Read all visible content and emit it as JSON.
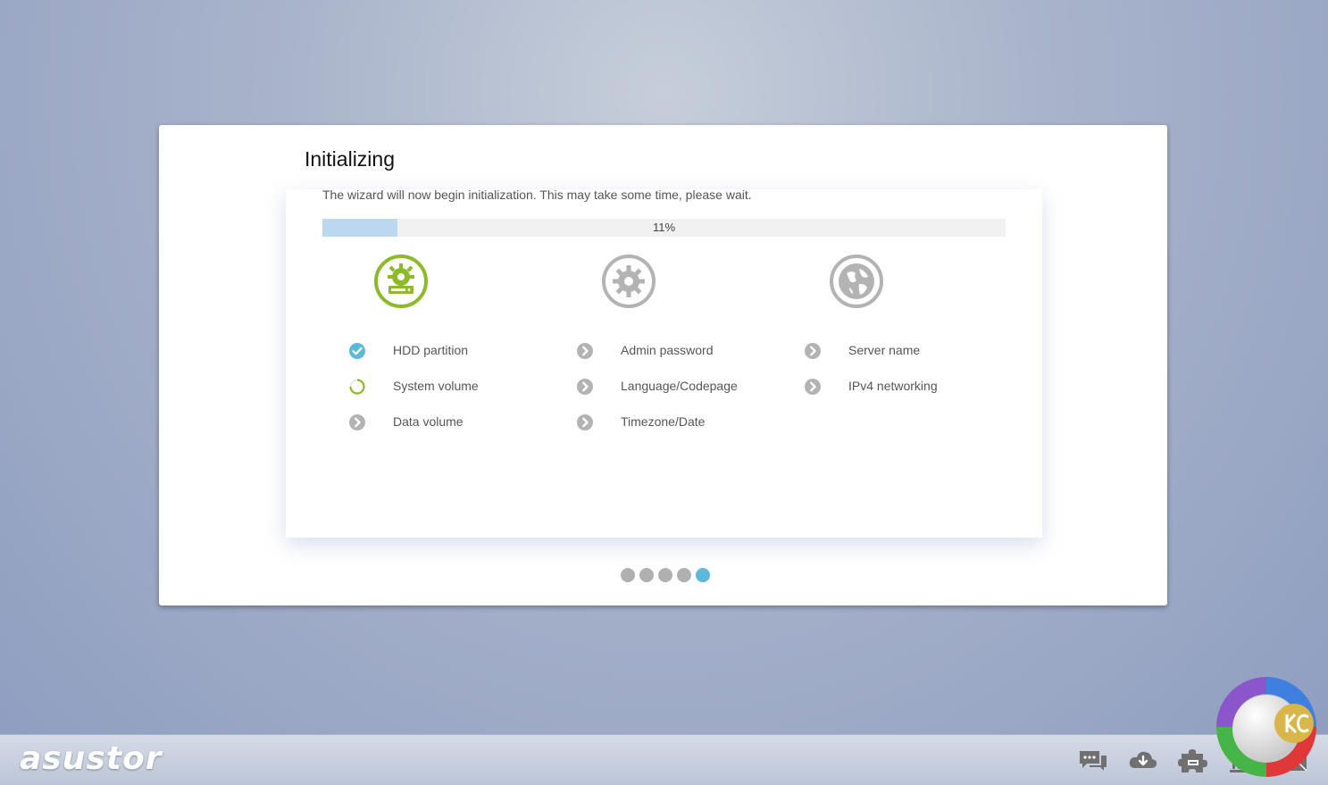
{
  "dialog": {
    "title": "Initializing",
    "description": "The wizard will now begin initialization. This may take some time, please wait.",
    "progress": {
      "percent": 11,
      "label": "11%"
    }
  },
  "columns": [
    {
      "icon": "hdd-gear-icon",
      "icon_color": "#8cba2a",
      "steps": [
        {
          "label": "HDD partition",
          "status": "done"
        },
        {
          "label": "System volume",
          "status": "in-progress"
        },
        {
          "label": "Data volume",
          "status": "pending"
        }
      ]
    },
    {
      "icon": "gear-icon",
      "icon_color": "#b3b3b3",
      "steps": [
        {
          "label": "Admin password",
          "status": "pending"
        },
        {
          "label": "Language/Codepage",
          "status": "pending"
        },
        {
          "label": "Timezone/Date",
          "status": "pending"
        }
      ]
    },
    {
      "icon": "globe-icon",
      "icon_color": "#b3b3b3",
      "steps": [
        {
          "label": "Server name",
          "status": "pending"
        },
        {
          "label": "IPv4 networking",
          "status": "pending"
        }
      ]
    }
  ],
  "pagination": {
    "total": 5,
    "active": 5
  },
  "taskbar": {
    "brand": "asustor",
    "tray_icons": [
      "chat-icon",
      "cloud-download-icon",
      "puzzle-icon",
      "museum-icon",
      "mail-icon"
    ]
  },
  "colors": {
    "accent_green": "#8cba2a",
    "accent_blue": "#5cb8dc",
    "progress_fill": "#bcd8f0",
    "inactive_gray": "#b3b3b3"
  }
}
